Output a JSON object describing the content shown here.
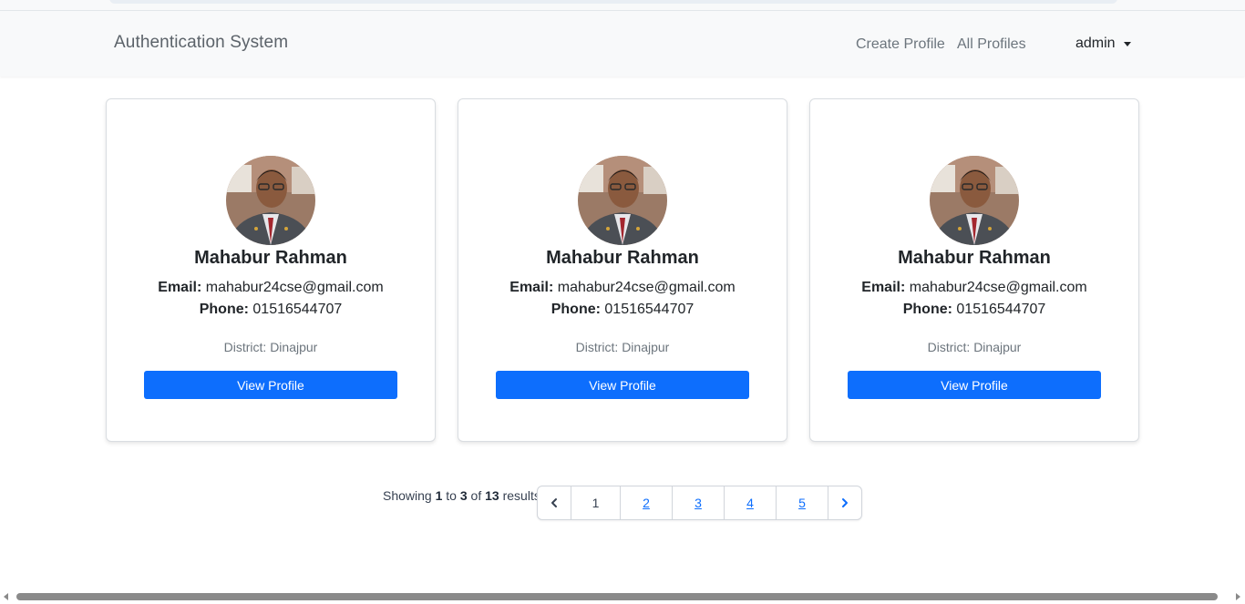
{
  "navbar": {
    "brand": "Authentication System",
    "links": [
      "Create Profile",
      "All Profiles"
    ],
    "user": "admin"
  },
  "profiles": [
    {
      "name": "Mahabur Rahman",
      "email_label": "Email:",
      "email": "mahabur24cse@gmail.com",
      "phone_label": "Phone:",
      "phone": "01516544707",
      "district": "District: Dinajpur",
      "button": "View Profile"
    },
    {
      "name": "Mahabur Rahman",
      "email_label": "Email:",
      "email": "mahabur24cse@gmail.com",
      "phone_label": "Phone:",
      "phone": "01516544707",
      "district": "District: Dinajpur",
      "button": "View Profile"
    },
    {
      "name": "Mahabur Rahman",
      "email_label": "Email:",
      "email": "mahabur24cse@gmail.com",
      "phone_label": "Phone:",
      "phone": "01516544707",
      "district": "District: Dinajpur",
      "button": "View Profile"
    }
  ],
  "pagination": {
    "showing": "Showing",
    "from": "1",
    "to_word": "to",
    "to": "3",
    "of_word": "of",
    "total": "13",
    "results": "results",
    "current": "1",
    "pages": [
      "2",
      "3",
      "4",
      "5"
    ],
    "prev_icon": "chevron-left-icon",
    "next_icon": "chevron-right-icon"
  },
  "colors": {
    "primary": "#0d6efd",
    "navbar_bg": "#f8f9fa"
  }
}
